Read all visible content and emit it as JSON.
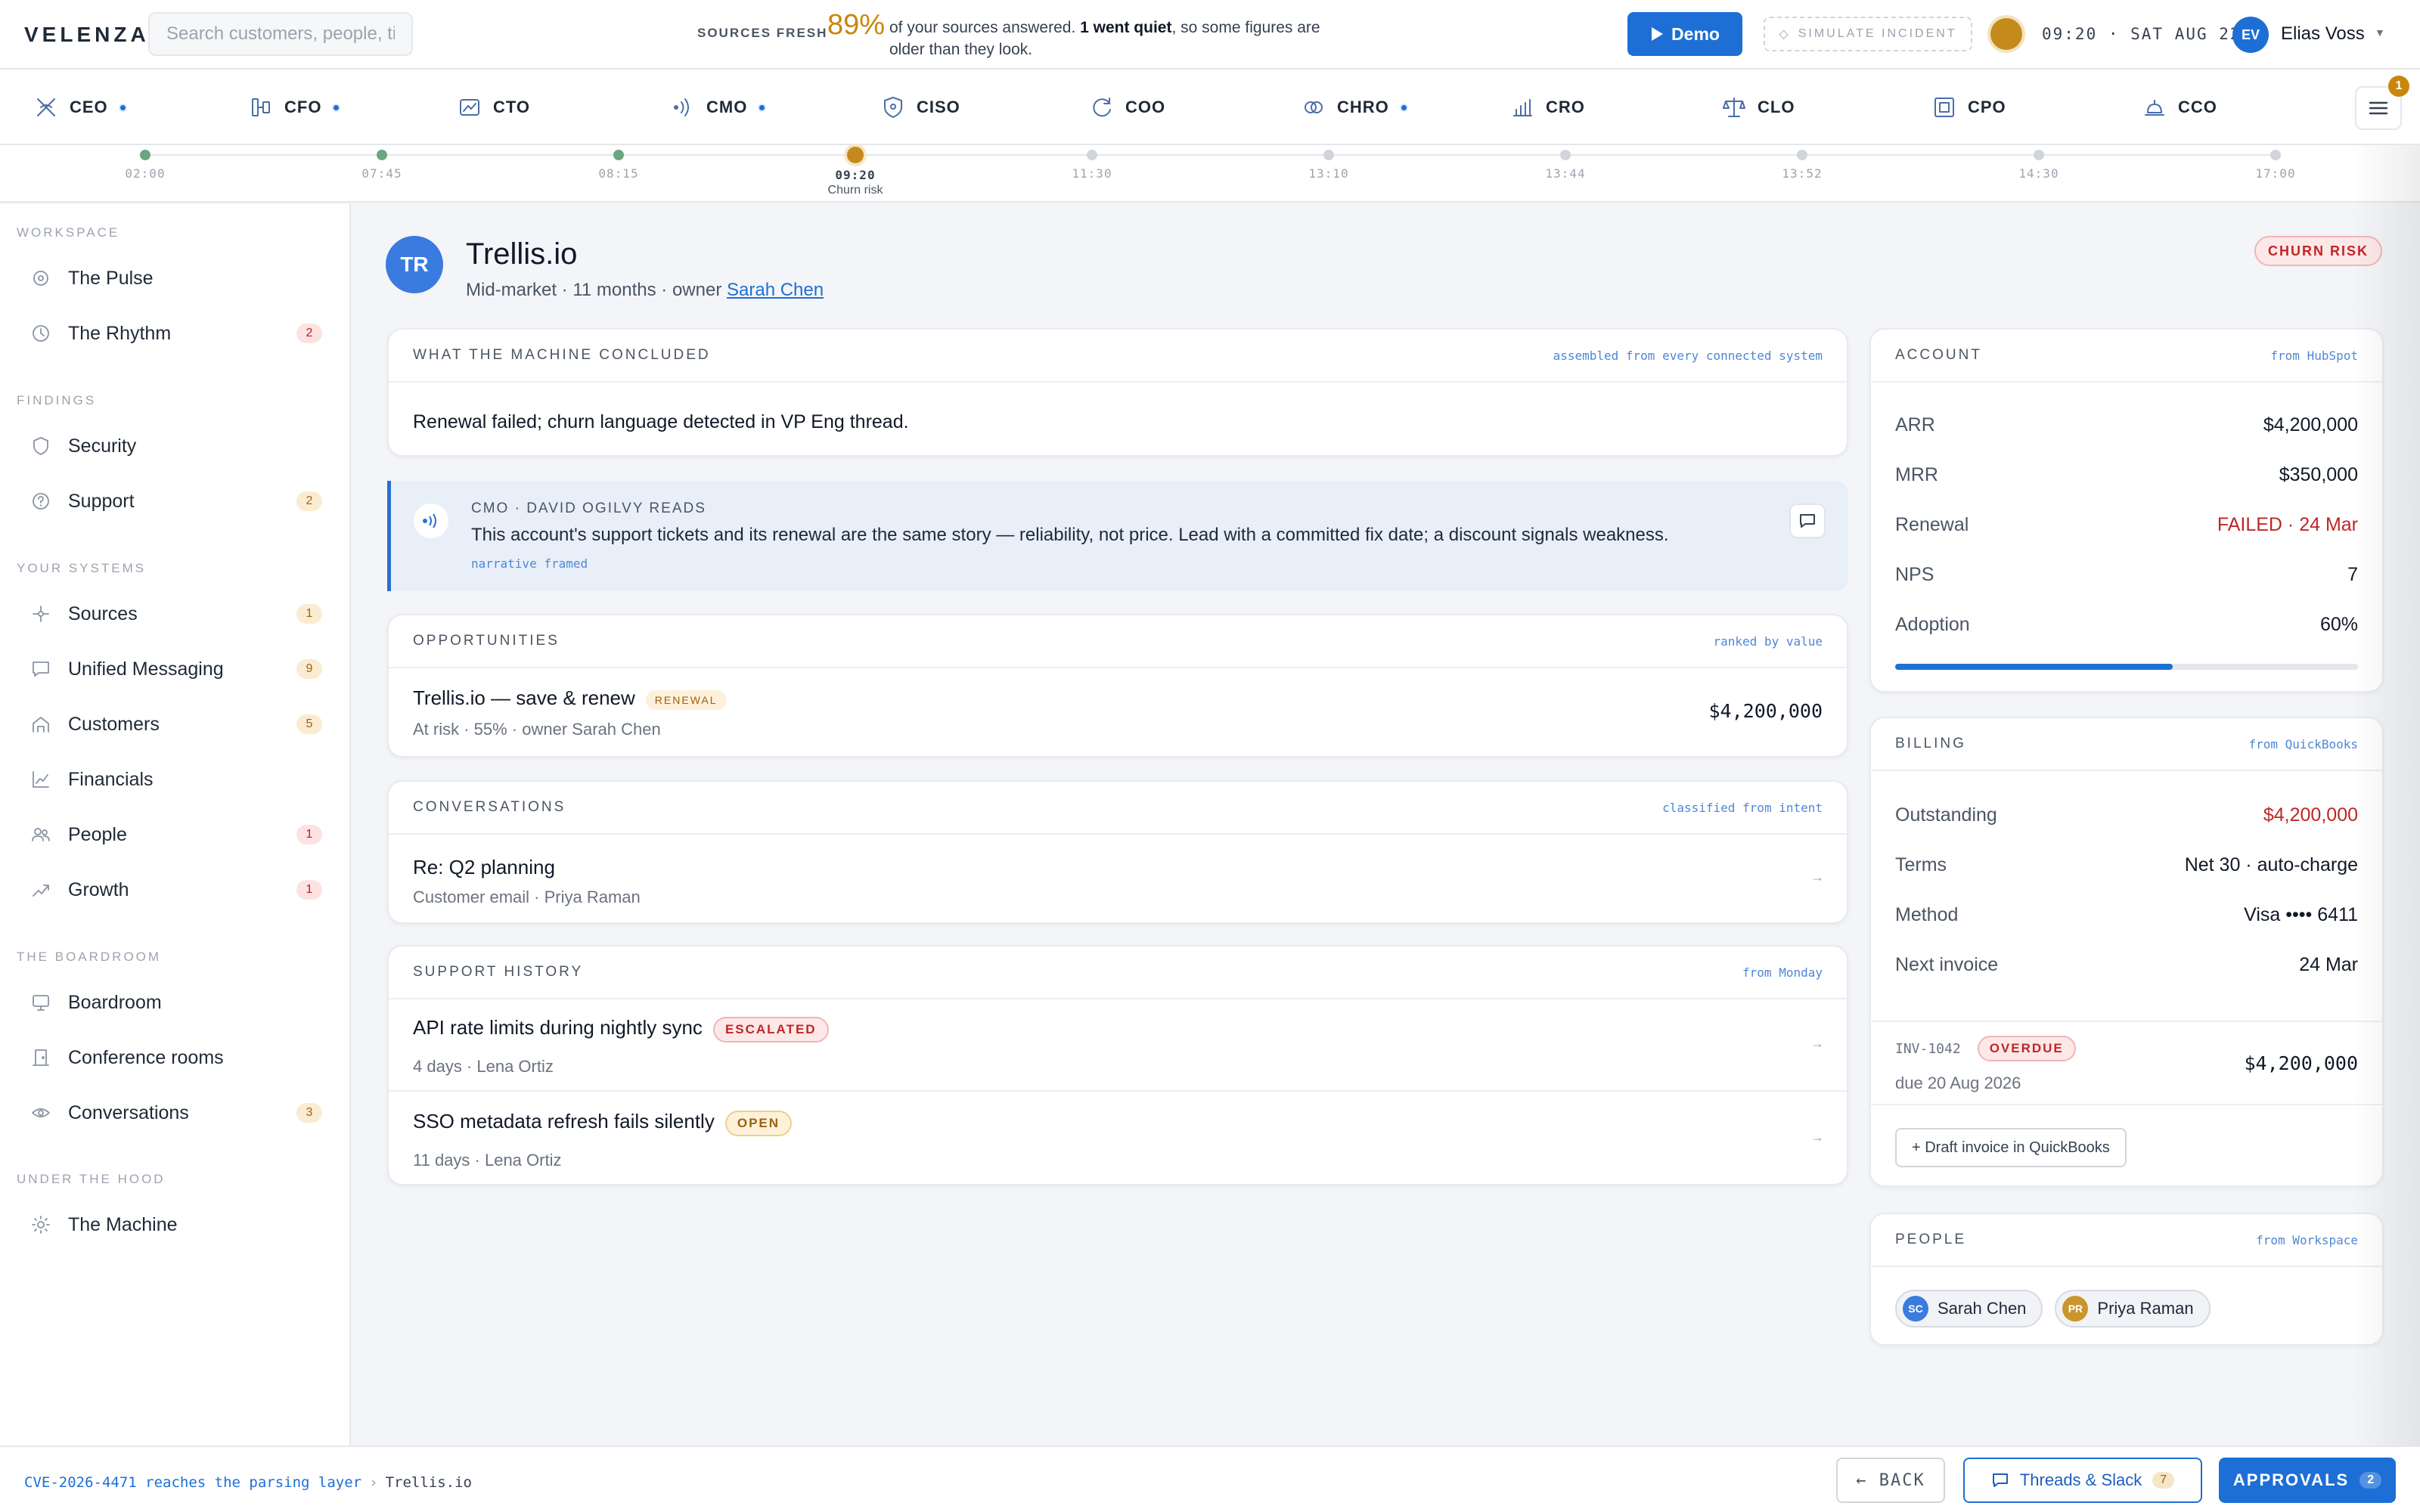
{
  "app": {
    "logo": "VELENZA."
  },
  "search": {
    "placeholder": "Search customers, people, ti"
  },
  "freshness": {
    "label": "SOURCES FRESH",
    "percent": "89%",
    "msg_a": "of your sources answered. ",
    "msg_b": "1 went quiet",
    "msg_c": ", so some figures are older than they look."
  },
  "toolbar": {
    "demo_label": "Demo",
    "simulate_label": "SIMULATE INCIDENT",
    "clock": "09:20 · SAT AUG 22",
    "user_initials": "EV",
    "user_name": "Elias Voss"
  },
  "roles": [
    {
      "label": "CEO",
      "icon": "ceo-icon",
      "dot": true
    },
    {
      "label": "CFO",
      "icon": "cfo-icon",
      "dot": true
    },
    {
      "label": "CTO",
      "icon": "cto-icon",
      "dot": false
    },
    {
      "label": "CMO",
      "icon": "cmo-icon",
      "dot": true
    },
    {
      "label": "CISO",
      "icon": "ciso-icon",
      "dot": false
    },
    {
      "label": "COO",
      "icon": "coo-icon",
      "dot": false
    },
    {
      "label": "CHRO",
      "icon": "chro-icon",
      "dot": true
    },
    {
      "label": "CRO",
      "icon": "cro-icon",
      "dot": false
    },
    {
      "label": "CLO",
      "icon": "clo-icon",
      "dot": false
    },
    {
      "label": "CPO",
      "icon": "cpo-icon",
      "dot": false
    },
    {
      "label": "CCO",
      "icon": "cco-icon",
      "dot": false
    }
  ],
  "menu_badge": "1",
  "timeline": [
    {
      "time": "02:00",
      "state": "done",
      "label": ""
    },
    {
      "time": "07:45",
      "state": "done",
      "label": ""
    },
    {
      "time": "08:15",
      "state": "done",
      "label": ""
    },
    {
      "time": "09:20",
      "state": "current",
      "label": "Churn risk"
    },
    {
      "time": "11:30",
      "state": "future",
      "label": ""
    },
    {
      "time": "13:10",
      "state": "future",
      "label": ""
    },
    {
      "time": "13:44",
      "state": "future",
      "label": ""
    },
    {
      "time": "13:52",
      "state": "future",
      "label": ""
    },
    {
      "time": "14:30",
      "state": "future",
      "label": ""
    },
    {
      "time": "17:00",
      "state": "future",
      "label": ""
    }
  ],
  "sidebar": {
    "sections": [
      "WORKSPACE",
      "FINDINGS",
      "YOUR SYSTEMS",
      "THE BOARDROOM",
      "UNDER THE HOOD"
    ],
    "items": [
      {
        "label": "The Pulse",
        "icon": "pulse-icon",
        "badge": "",
        "tone": ""
      },
      {
        "label": "The Rhythm",
        "icon": "clock-icon",
        "badge": "2",
        "tone": "red"
      },
      {
        "label": "Security",
        "icon": "shield-icon",
        "badge": "",
        "tone": ""
      },
      {
        "label": "Support",
        "icon": "help-icon",
        "badge": "2",
        "tone": "amber"
      },
      {
        "label": "Sources",
        "icon": "sources-icon",
        "badge": "1",
        "tone": "amber"
      },
      {
        "label": "Unified Messaging",
        "icon": "message-icon",
        "badge": "9",
        "tone": "amber"
      },
      {
        "label": "Customers",
        "icon": "customers-icon",
        "badge": "5",
        "tone": "amber"
      },
      {
        "label": "Financials",
        "icon": "chart-icon",
        "badge": "",
        "tone": ""
      },
      {
        "label": "People",
        "icon": "people-icon",
        "badge": "1",
        "tone": "red"
      },
      {
        "label": "Growth",
        "icon": "growth-icon",
        "badge": "1",
        "tone": "red"
      },
      {
        "label": "Boardroom",
        "icon": "monitor-icon",
        "badge": "",
        "tone": ""
      },
      {
        "label": "Conference rooms",
        "icon": "door-icon",
        "badge": "",
        "tone": ""
      },
      {
        "label": "Conversations",
        "icon": "eye-icon",
        "badge": "3",
        "tone": "amber"
      },
      {
        "label": "The Machine",
        "icon": "gear-icon",
        "badge": "",
        "tone": ""
      }
    ]
  },
  "account": {
    "initials": "TR",
    "name": "Trellis.io",
    "meta": "Mid-market · 11 months · owner ",
    "owner": "Sarah Chen",
    "status_badge": "CHURN RISK"
  },
  "conclusion": {
    "title": "WHAT THE MACHINE CONCLUDED",
    "source": "assembled from every connected system",
    "text": "Renewal failed; churn language detected in VP Eng thread."
  },
  "cmo_note": {
    "label": "CMO · DAVID OGILVY READS",
    "text": "This account's support tickets and its renewal are the same story — reliability, not price. Lead with a committed fix date; a discount signals weakness.",
    "tag": "narrative framed"
  },
  "opportunities": {
    "title": "OPPORTUNITIES",
    "source": "ranked by value",
    "items": [
      {
        "name": "Trellis.io — save & renew",
        "tag": "RENEWAL",
        "sub": "At risk · 55% · owner Sarah Chen",
        "value": "$4,200,000"
      }
    ]
  },
  "conversations": {
    "title": "CONVERSATIONS",
    "source": "classified from intent",
    "items": [
      {
        "subject": "Re: Q2 planning",
        "sub": "Customer email · Priya Raman",
        "arrow": "→"
      }
    ]
  },
  "support": {
    "title": "SUPPORT HISTORY",
    "source": "from Monday",
    "items": [
      {
        "title": "API rate limits during nightly sync",
        "status": "ESCALATED",
        "tone": "red",
        "sub": "4 days · Lena Ortiz",
        "arrow": "→"
      },
      {
        "title": "SSO metadata refresh fails silently",
        "status": "OPEN",
        "tone": "amber",
        "sub": "11 days · Lena Ortiz",
        "arrow": "→"
      }
    ]
  },
  "account_card": {
    "title": "ACCOUNT",
    "source": "from HubSpot",
    "rows": [
      {
        "label": "ARR",
        "value": "$4,200,000"
      },
      {
        "label": "MRR",
        "value": "$350,000"
      },
      {
        "label": "Renewal",
        "value": "FAILED · 24 Mar"
      },
      {
        "label": "NPS",
        "value": "7"
      },
      {
        "label": "Adoption",
        "value": "60%"
      }
    ],
    "adoption_fraction": 0.6,
    "danger_color": "#c02626"
  },
  "billing": {
    "title": "BILLING",
    "source": "from QuickBooks",
    "rows": [
      {
        "label": "Outstanding",
        "value": "$4,200,000"
      },
      {
        "label": "Terms",
        "value": "Net 30 · auto-charge"
      },
      {
        "label": "Method",
        "value": "Visa •••• 6411"
      },
      {
        "label": "Next invoice",
        "value": "24 Mar"
      }
    ],
    "invoice": {
      "id": "INV-1042",
      "status": "OVERDUE",
      "due": "due 20 Aug 2026",
      "amount": "$4,200,000"
    },
    "draft_button": "+ Draft invoice in QuickBooks"
  },
  "people": {
    "title": "PEOPLE",
    "source": "from Workspace",
    "items": [
      {
        "initials": "SC",
        "name": "Sarah Chen",
        "color": "#3a7be0"
      },
      {
        "initials": "PR",
        "name": "Priya Raman",
        "color": "#c9962c"
      }
    ]
  },
  "bottom": {
    "crumb_link": "CVE-2026-4471 reaches the parsing layer",
    "crumb_sep": "›",
    "crumb_current": "Trellis.io",
    "back": "← BACK",
    "threads": "Threads & Slack",
    "threads_count": "7",
    "approvals": "APPROVALS",
    "approvals_count": "2"
  },
  "colors": {
    "accent": "#1d6fd6",
    "warn": "#c9860b",
    "danger": "#c02626"
  }
}
